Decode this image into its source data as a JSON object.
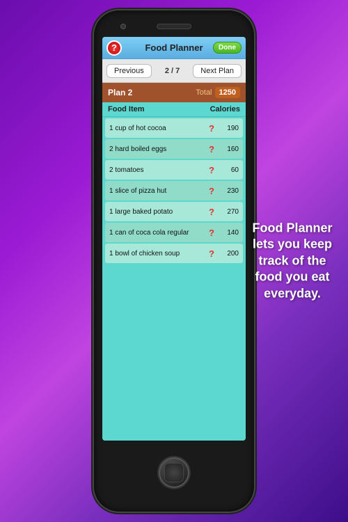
{
  "phone": {
    "header": {
      "title": "Food Planner",
      "done_label": "Done"
    },
    "nav": {
      "previous_label": "Previous",
      "page_indicator": "2 / 7",
      "next_label": "Next Plan"
    },
    "plan": {
      "title": "Plan 2",
      "total_label": "Total",
      "total_value": "1250"
    },
    "table": {
      "col_food": "Food Item",
      "col_calories": "Calories"
    },
    "food_items": [
      {
        "name": "1 cup of hot cocoa",
        "calories": "190"
      },
      {
        "name": "2 hard boiled eggs",
        "calories": "160"
      },
      {
        "name": "2 tomatoes",
        "calories": "60"
      },
      {
        "name": "1 slice of pizza hut",
        "calories": "230"
      },
      {
        "name": "1 large baked potato",
        "calories": "270"
      },
      {
        "name": "1 can of coca cola regular",
        "calories": "140"
      },
      {
        "name": "1 bowl of chicken soup",
        "calories": "200"
      }
    ]
  },
  "side_text": "Food Planner lets you keep track of the food you eat everyday."
}
